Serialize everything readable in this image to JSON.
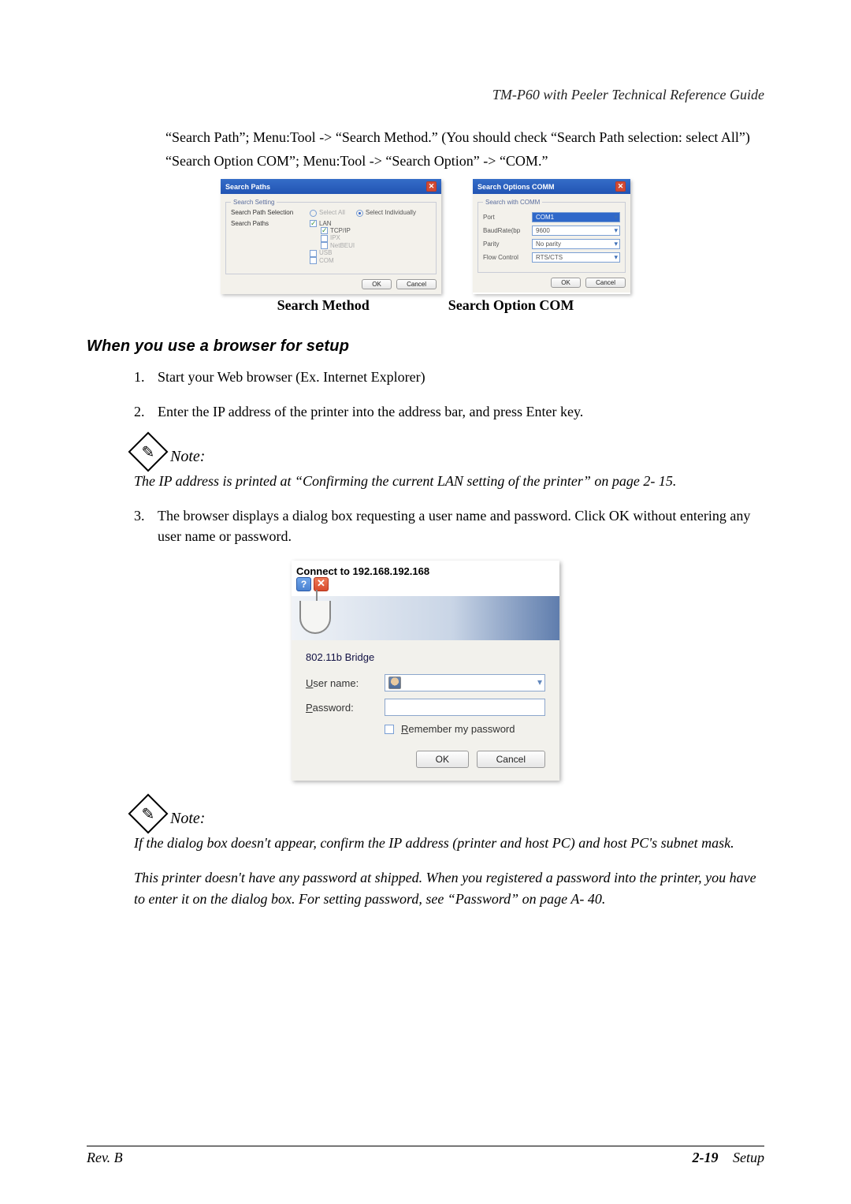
{
  "header": {
    "doc_title": "TM-P60 with Peeler Technical Reference Guide"
  },
  "intro": {
    "line1": "“Search Path”; Menu:Tool -> “Search Method.” (You should check “Search Path selection: select All”)",
    "line2": "“Search Option COM”; Menu:Tool -> “Search Option” ->  “COM.”"
  },
  "search_method": {
    "window_title": "Search Paths",
    "group_label": "Search Setting",
    "row_path_sel": "Search Path Selection",
    "radio_all": "Select All",
    "radio_indiv": "Select Individually",
    "row_paths": "Search Paths",
    "lan": "LAN",
    "tcpip": "TCP/IP",
    "ipx": "IPX",
    "netbeui": "NetBEUI",
    "usb": "USB",
    "com": "COM",
    "ok": "OK",
    "cancel": "Cancel",
    "caption": "Search Method"
  },
  "search_option": {
    "window_title": "Search Options COMM",
    "group_label": "Search with COMM",
    "port_lbl": "Port",
    "port_val": "COM1",
    "baud_lbl": "BaudRate(bp",
    "baud_val": "9600",
    "parity_lbl": "Parity",
    "parity_val": "No parity",
    "flow_lbl": "Flow Control",
    "flow_val": "RTS/CTS",
    "ok": "OK",
    "cancel": "Cancel",
    "caption": "Search Option COM"
  },
  "heading": "When you use a browser for setup",
  "steps": {
    "s1": "Start your Web browser (Ex. Internet Explorer)",
    "s2": "Enter the IP address of the printer into the address bar, and press Enter key.",
    "s3": "The browser displays a dialog box requesting a user name and password. Click OK without entering any user name or password."
  },
  "note1": {
    "label": "Note:",
    "text": "The IP address is printed at “Confirming the current LAN setting of the printer” on page 2- 15."
  },
  "connect": {
    "title": "Connect to 192.168.192.168",
    "bridge": "802.11b Bridge",
    "user_prefix": "U",
    "user_rest": "ser name:",
    "pass_prefix": "P",
    "pass_rest": "assword:",
    "remember_prefix": "R",
    "remember_rest": "emember my password",
    "ok": "OK",
    "cancel": "Cancel"
  },
  "note2": {
    "label": "Note:",
    "p1": "If the dialog box doesn't appear, confirm the IP address (printer and host PC) and host PC's subnet mask.",
    "p2": "This printer doesn't have any password at shipped. When you registered a password into the printer, you have to enter it on the dialog box. For setting password, see “Password” on page A- 40."
  },
  "footer": {
    "left": "Rev. B",
    "page": "2-19",
    "section": "Setup"
  }
}
